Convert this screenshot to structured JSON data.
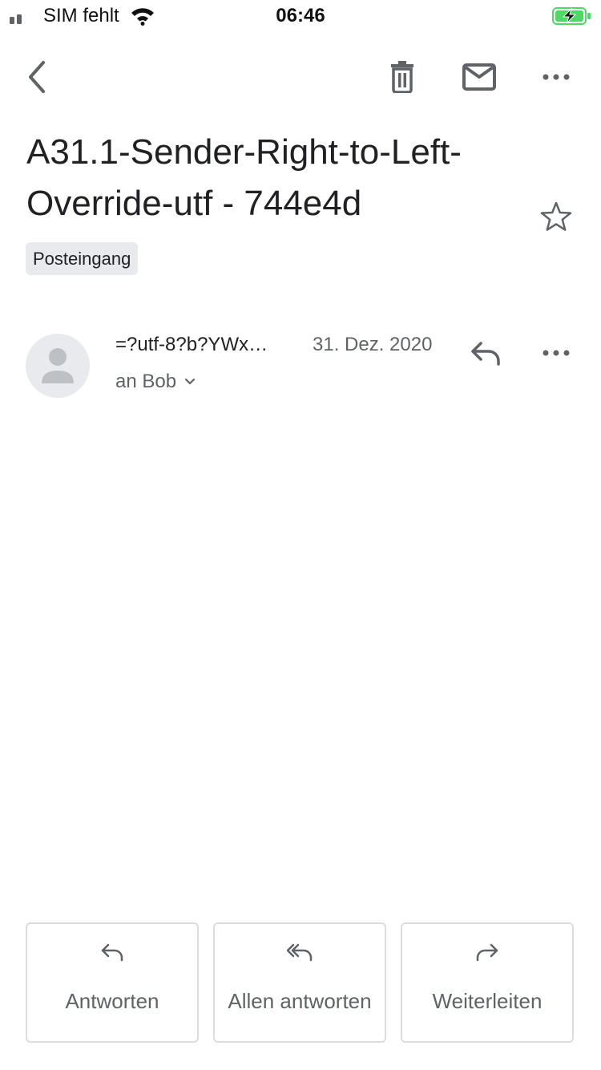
{
  "status_bar": {
    "carrier": "SIM fehlt",
    "time": "06:46",
    "battery_color": "#4cd964"
  },
  "toolbar": {
    "back_icon": "chevron-left-icon",
    "delete_icon": "trash-icon",
    "mark_unread_icon": "mail-icon",
    "more_icon": "more-horizontal-icon"
  },
  "email": {
    "subject": "A31.1-Sender-Right-to-Left-Override-utf - 744e4d",
    "label": "Posteingang",
    "starred": false
  },
  "message": {
    "sender": "=?utf-8?b?YWx…",
    "date": "31. Dez. 2020",
    "recipient": "an Bob"
  },
  "actions": {
    "reply_label": "Antworten",
    "reply_all_label": "Allen antworten",
    "forward_label": "Weiterleiten"
  },
  "colors": {
    "text_primary": "#202124",
    "text_secondary": "#5f6368",
    "chip_background": "#e8eaed",
    "border": "#dadce0"
  }
}
